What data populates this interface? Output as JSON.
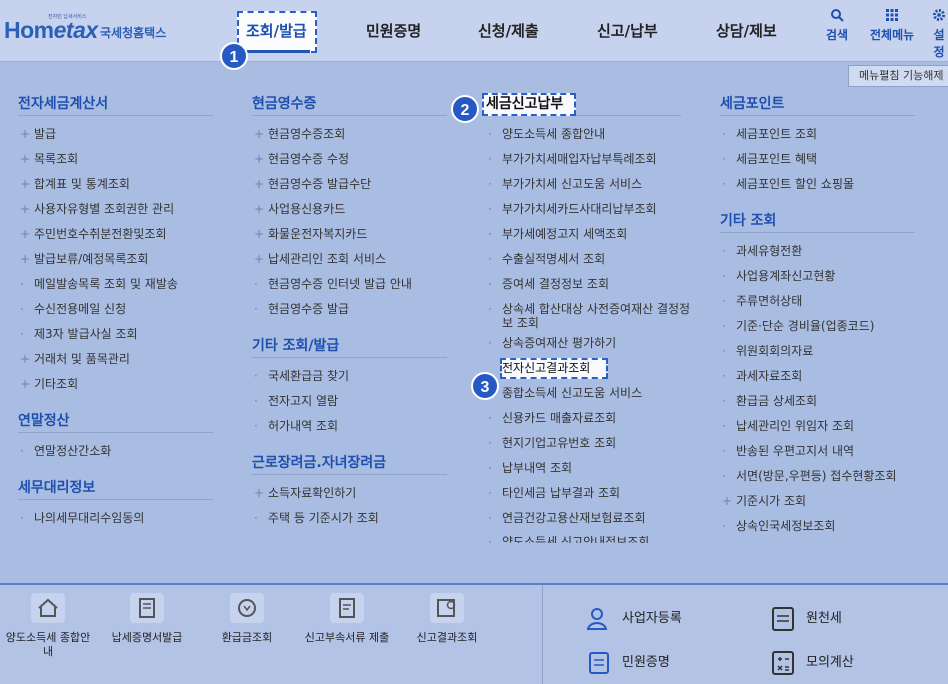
{
  "header": {
    "logo_top": "전자민 납세서비스",
    "logo_brand_a": "Hom",
    "logo_brand_b": "etax",
    "logo_sub": "국세청홈택스",
    "nav": [
      "조회/발급",
      "민원증명",
      "신청/제출",
      "신고/납부",
      "상담/제보"
    ],
    "search_label": "검색",
    "all_menu_label": "전체메뉴",
    "settings_label": "설정"
  },
  "menu_toggle": "메뉴펼침 기능해제",
  "badges": [
    "1",
    "2",
    "3"
  ],
  "columns": {
    "c1": {
      "cat1": "전자세금계산서",
      "items1": [
        "발급",
        "목록조회",
        "합계표 및 통계조회",
        "사용자유형별 조회권한 관리",
        "주민번호수취분전환및조회",
        "발급보류/예정목록조회",
        "메일발송목록 조회 및 재발송",
        "수신전용메일 신청",
        "제3자 발급사실 조회",
        "거래처 및 품목관리",
        "기타조회"
      ],
      "cat2": "연말정산",
      "items2": [
        "연말정산간소화"
      ],
      "cat3": "세무대리정보",
      "items3": [
        "나의세무대리수임동의"
      ]
    },
    "c2": {
      "cat1": "현금영수증",
      "items1": [
        "현금영수증조회",
        "현금영수증 수정",
        "현금영수증 발급수단",
        "사업용신용카드",
        "화물운전자복지카드",
        "납세관리인 조회 서비스",
        "현금영수증 인터넷 발급 안내",
        "현금영수증 발급"
      ],
      "cat2": "기타 조회/발급",
      "items2": [
        "국세환급금 찾기",
        "전자고지 열람",
        "허가내역 조회"
      ],
      "cat3": "근로장려금.자녀장려금",
      "items3": [
        "소득자료확인하기",
        "주택 등 기준시가 조회"
      ]
    },
    "c3": {
      "cat1": "세금신고납부",
      "items1": [
        "양도소득세 종합안내",
        "부가가치세매입자납부특례조회",
        "부가가치세 신고도움 서비스",
        "부가가치세카드사대리납부조회",
        "부가세예정고지 세액조회",
        "수출실적명세서 조회",
        "증여세 결정정보 조회"
      ],
      "item_two": "상속세 합산대상 사전증여재산 결정정보 조회",
      "items2": [
        "상속증여재산 평가하기",
        "전자신고결과조회",
        "종합소득세 신고도움 서비스",
        "신용카드 매출자료조회",
        "현지기업고유번호 조회",
        "납부내역 조회",
        "타인세금 납부결과 조회",
        "연금건강고용산재보험료조회",
        "양도소득세 신고안내정보조회"
      ]
    },
    "c4": {
      "cat1": "세금포인트",
      "items1": [
        "세금포인트 조회",
        "세금포인트 혜택",
        "세금포인트 할인 쇼핑몰"
      ],
      "cat2": "기타 조회",
      "items2": [
        "과세유형전환",
        "사업용계좌신고현황",
        "주류면허상태",
        "기준·단순 경비율(업종코드)",
        "위원회회의자료",
        "과세자료조회",
        "환급금 상세조회",
        "납세관리인 위임자 조회",
        "반송된 우편고지서 내역",
        "서면(방문,우편등) 접수현황조회",
        "기준시가 조회",
        "상속인국세정보조회"
      ]
    }
  },
  "quick": [
    "양도소득세 종합안내",
    "납세증명서발급",
    "환급금조회",
    "신고부속서류 제출",
    "신고결과조회"
  ],
  "right_quick": [
    "사업자등록",
    "원천세",
    "민원증명",
    "모의계산"
  ],
  "colors": {
    "accent": "#2759c4",
    "background": "#a9bde2"
  }
}
